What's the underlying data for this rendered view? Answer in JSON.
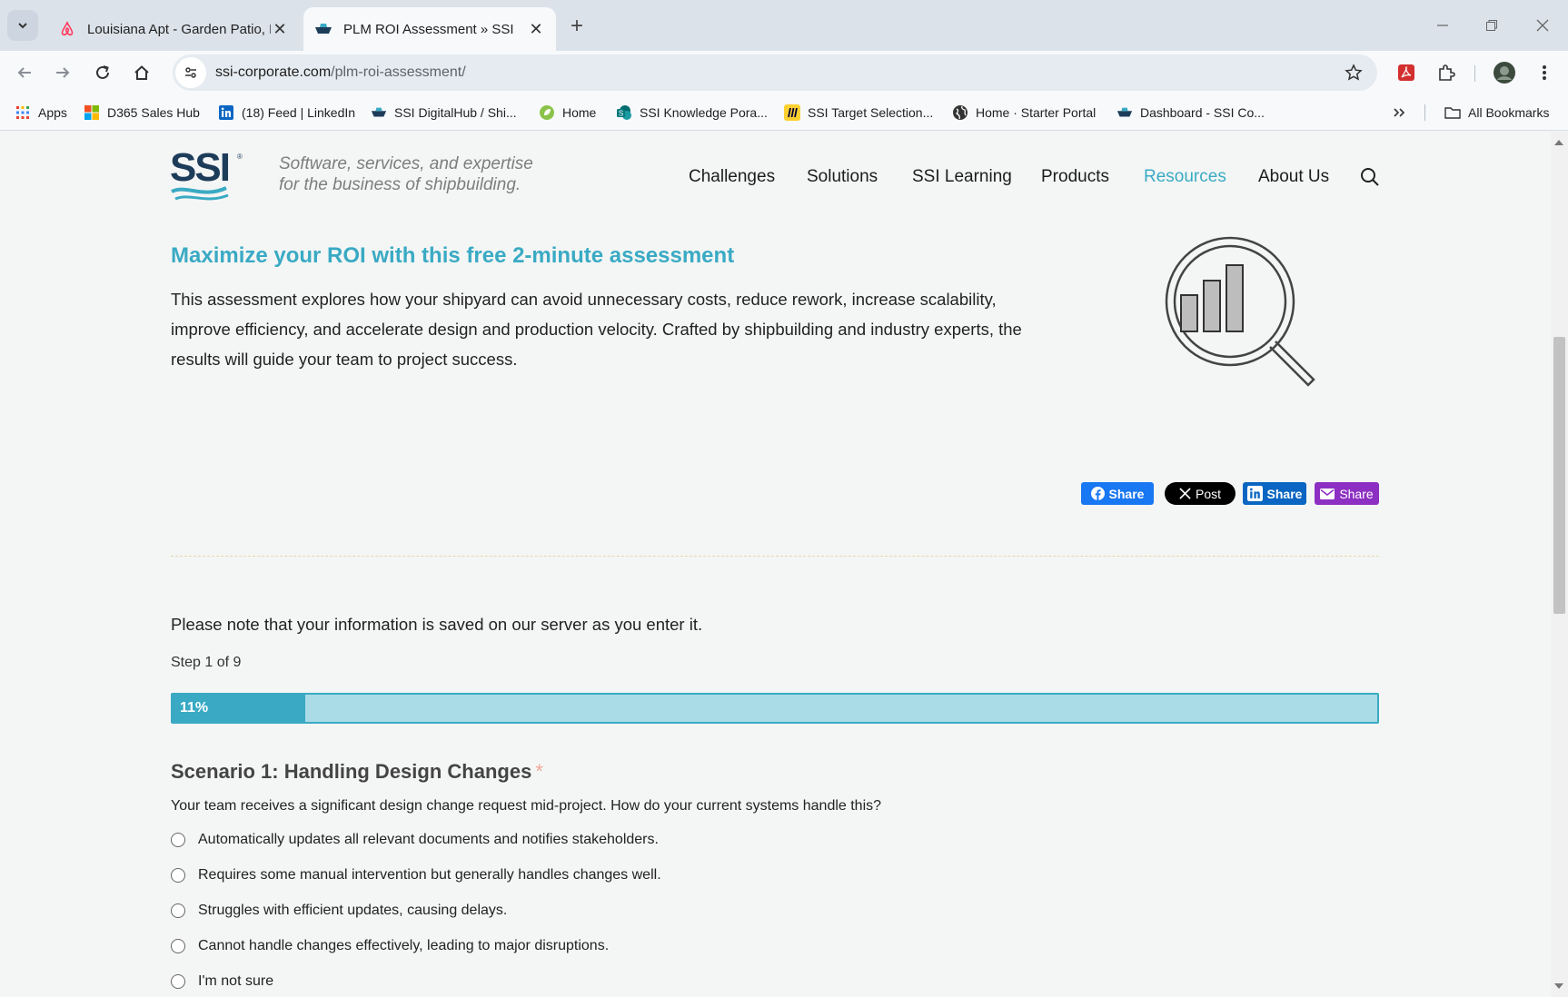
{
  "tabs": [
    {
      "title": "Louisiana Apt - Garden Patio, N",
      "favicon": "airbnb-icon",
      "active": false
    },
    {
      "title": "PLM ROI Assessment » SSI",
      "favicon": "ssi-ship-icon",
      "active": true
    }
  ],
  "address_bar": {
    "domain": "ssi-corporate.com",
    "path": "/plm-roi-assessment/"
  },
  "bookmarks": [
    {
      "label": "Apps",
      "icon": "apps-grid-icon"
    },
    {
      "label": "D365 Sales Hub",
      "icon": "microsoft-icon"
    },
    {
      "label": "(18) Feed | LinkedIn",
      "icon": "linkedin-icon"
    },
    {
      "label": "SSI DigitalHub / Shi...",
      "icon": "ssi-ship-icon"
    },
    {
      "label": "Home",
      "icon": "leaf-icon"
    },
    {
      "label": "SSI Knowledge Pora...",
      "icon": "sharepoint-icon"
    },
    {
      "label": "SSI Target Selection...",
      "icon": "miro-icon"
    },
    {
      "label": "Home · Starter Portal",
      "icon": "globe-icon"
    },
    {
      "label": "Dashboard - SSI Co...",
      "icon": "ssi-ship-icon"
    }
  ],
  "all_bookmarks_label": "All Bookmarks",
  "site": {
    "logo_text": "SSI",
    "tagline_line1": "Software, services, and expertise",
    "tagline_line2": "for the business of shipbuilding.",
    "nav": [
      "Challenges",
      "Solutions",
      "SSI Learning",
      "Products",
      "Resources",
      "About Us"
    ],
    "nav_active": "Resources"
  },
  "hero": {
    "title": "Maximize your ROI with this free 2-minute assessment",
    "description": "This assessment explores how your shipyard can avoid unnecessary costs, reduce rework, increase scalability, improve efficiency, and accelerate design and production velocity. Crafted by shipbuilding and industry experts, the results will guide your team to project success."
  },
  "share_buttons": [
    {
      "label": "Share",
      "network": "facebook",
      "color": "#1877f2"
    },
    {
      "label": "Post",
      "network": "x",
      "color": "#000000"
    },
    {
      "label": "Share",
      "network": "linkedin",
      "color": "#0a66c2"
    },
    {
      "label": "Share",
      "network": "email",
      "color": "#8c2fc2"
    }
  ],
  "form": {
    "note": "Please note that your information is saved on our server as you enter it.",
    "step_label": "Step 1 of 9",
    "progress_percent": 11,
    "progress_label": "11%",
    "question_title": "Scenario 1: Handling Design Changes",
    "required_mark": "*",
    "question_text": "Your team receives a significant design change request mid-project. How do your current systems handle this?",
    "options": [
      "Automatically updates all relevant documents and notifies stakeholders.",
      "Requires some manual intervention but generally handles changes well.",
      "Struggles with efficient updates, causing delays.",
      "Cannot handle changes effectively, leading to major disruptions.",
      "I'm not sure"
    ]
  },
  "colors": {
    "accent": "#3aaac4",
    "progress_track": "#a9dce6",
    "logo_navy": "#1d3c5a"
  }
}
